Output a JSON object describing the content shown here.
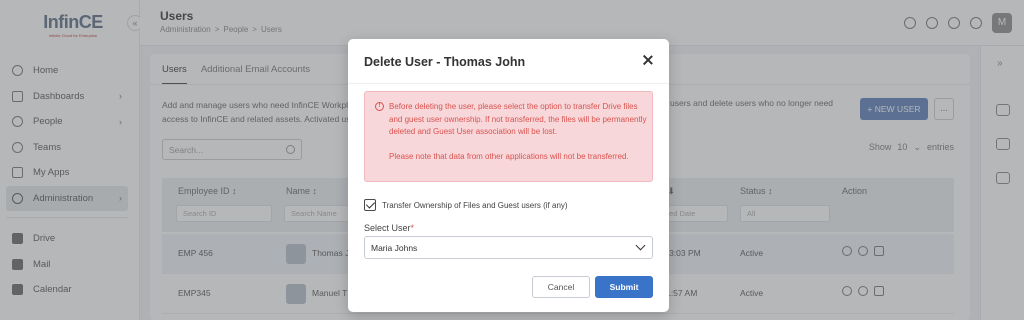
{
  "logo": {
    "main": "InfinCE",
    "sub": "Infinite Cloud for Enterprise"
  },
  "header": {
    "title": "Users",
    "breadcrumb": [
      "Administration",
      "People",
      "Users"
    ],
    "breadcrumb_sep": ">",
    "avatar_initial": "M"
  },
  "sidebar": {
    "items": [
      {
        "label": "Home",
        "icon": "home-icon",
        "chevron": false
      },
      {
        "label": "Dashboards",
        "icon": "dashboard-icon",
        "chevron": true
      },
      {
        "label": "People",
        "icon": "people-icon",
        "chevron": true
      },
      {
        "label": "Teams",
        "icon": "teams-icon",
        "chevron": false
      },
      {
        "label": "My Apps",
        "icon": "apps-icon",
        "chevron": false
      },
      {
        "label": "Administration",
        "icon": "gear-icon",
        "chevron": true,
        "active": true
      }
    ],
    "app_items": [
      {
        "label": "Drive",
        "icon": "drive-icon"
      },
      {
        "label": "Mail",
        "icon": "mail-icon"
      },
      {
        "label": "Calendar",
        "icon": "calendar-icon"
      }
    ]
  },
  "main": {
    "tabs": [
      "Users",
      "Additional Email Accounts"
    ],
    "description_line1": "Add and manage users who need InfinCE Workpla",
    "description_line2": "access to InfinCE and related assets. Activated use",
    "description_right": "users and delete users who no longer need",
    "new_user_label": "+ NEW USER",
    "more_label": "...",
    "search_placeholder": "Search...",
    "show_label": "Show",
    "show_value": "10",
    "entries_label": "entries",
    "columns": [
      {
        "label": "Employee ID ↕",
        "filter": "Search ID"
      },
      {
        "label": "Name ↕",
        "filter": "Search Name"
      },
      {
        "label": "e ⬇",
        "filter": "ted Date"
      },
      {
        "label": "Status ↕",
        "filter": "All"
      },
      {
        "label": "Action",
        "filter": ""
      }
    ],
    "rows": [
      {
        "id": "EMP 456",
        "name": "Thomas J",
        "date": ":03:03 PM",
        "status": "Active"
      },
      {
        "id": "EMP345",
        "name": "Manuel T",
        "date": "11:57 AM",
        "status": "Active"
      }
    ]
  },
  "modal": {
    "title": "Delete User - Thomas John",
    "warning_p1": "Before deleting the user, please select the option to transfer Drive files and guest user ownership. If not transferred, the files will be permanently deleted and Guest User association will be lost.",
    "warning_p2": "Please note that data from other applications will not be transferred.",
    "checkbox_label": "Transfer Ownership of Files and Guest users (if any)",
    "checkbox_checked": true,
    "select_label": "Select User",
    "select_required": "*",
    "select_value": "Maria Johns",
    "cancel_label": "Cancel",
    "submit_label": "Submit"
  },
  "colors": {
    "primary": "#3a74c9",
    "warning_bg": "#f8d7da",
    "warning_text": "#d9534f",
    "overlay": "rgba(90,95,100,0.45)"
  }
}
